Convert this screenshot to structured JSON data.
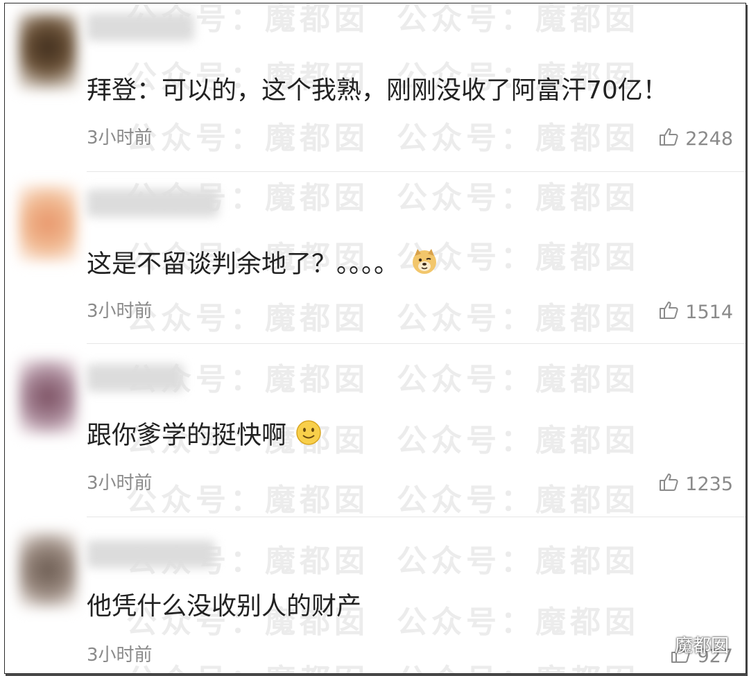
{
  "watermark": "公众号：魔都囡",
  "brand": {
    "name": "魔都囡",
    "icon": "wechat-icon"
  },
  "comments": [
    {
      "text": "拜登：可以的，这个我熟，刚刚没收了阿富汗70亿！",
      "time": "3小时前",
      "likes": "2248",
      "avatar_color": "#5a4632",
      "emoji": ""
    },
    {
      "text": "这是不留谈判余地了？。。。。",
      "time": "3小时前",
      "likes": "1514",
      "avatar_color": "#e0a070",
      "emoji": "doge-emoji"
    },
    {
      "text": "跟你爹学的挺快啊",
      "time": "3小时前",
      "likes": "1235",
      "avatar_color": "#8a5f70",
      "emoji": "smile-emoji"
    },
    {
      "text": "他凭什么没收别人的财产",
      "time": "3小时前",
      "likes": "927",
      "avatar_color": "#7a6a60",
      "emoji": ""
    }
  ]
}
